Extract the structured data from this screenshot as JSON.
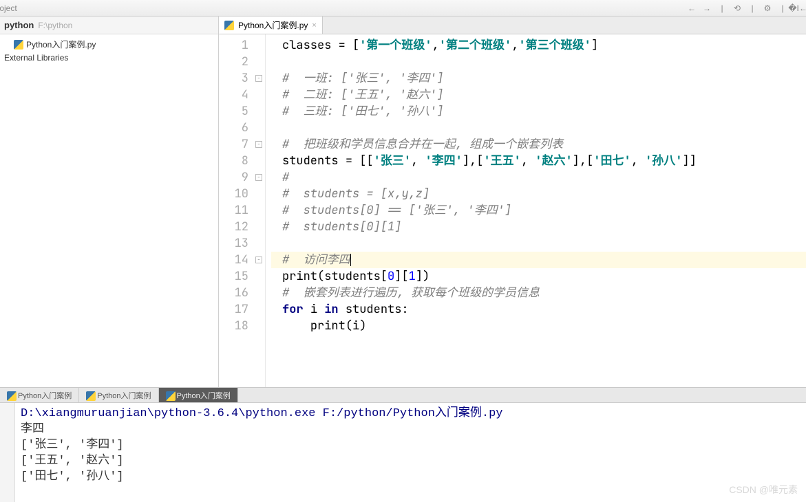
{
  "toolbar": {
    "icons": [
      "oject",
      "back",
      "forward",
      "sync",
      "gear",
      "collapse"
    ]
  },
  "project": {
    "name": "python",
    "path": "F:\\python",
    "file": "Python入门案例.py",
    "external_libs": "External Libraries"
  },
  "editor_tab": {
    "label": "Python入门案例.py"
  },
  "code": {
    "lines": [
      {
        "n": 1,
        "tokens": [
          {
            "t": "id",
            "v": "classes "
          },
          {
            "t": "op",
            "v": "= ["
          },
          {
            "t": "str",
            "v": "'第一个班级'"
          },
          {
            "t": "op",
            "v": ","
          },
          {
            "t": "str",
            "v": "'第二个班级'"
          },
          {
            "t": "op",
            "v": ","
          },
          {
            "t": "str",
            "v": "'第三个班级'"
          },
          {
            "t": "op",
            "v": "]"
          }
        ]
      },
      {
        "n": 2,
        "tokens": []
      },
      {
        "n": 3,
        "fold": true,
        "tokens": [
          {
            "t": "com",
            "v": "#  一班: ['张三', '李四']"
          }
        ]
      },
      {
        "n": 4,
        "tokens": [
          {
            "t": "com",
            "v": "#  二班: ['王五', '赵六']"
          }
        ]
      },
      {
        "n": 5,
        "tokens": [
          {
            "t": "com",
            "v": "#  三班: ['田七', '孙八']"
          }
        ]
      },
      {
        "n": 6,
        "tokens": []
      },
      {
        "n": 7,
        "fold": true,
        "tokens": [
          {
            "t": "com",
            "v": "#  把班级和学员信息合并在一起, 组成一个嵌套列表"
          }
        ]
      },
      {
        "n": 8,
        "tokens": [
          {
            "t": "id",
            "v": "students "
          },
          {
            "t": "op",
            "v": "= [["
          },
          {
            "t": "str",
            "v": "'张三'"
          },
          {
            "t": "op",
            "v": ", "
          },
          {
            "t": "str",
            "v": "'李四'"
          },
          {
            "t": "op",
            "v": "],["
          },
          {
            "t": "str",
            "v": "'王五'"
          },
          {
            "t": "op",
            "v": ", "
          },
          {
            "t": "str",
            "v": "'赵六'"
          },
          {
            "t": "op",
            "v": "],["
          },
          {
            "t": "str",
            "v": "'田七'"
          },
          {
            "t": "op",
            "v": ", "
          },
          {
            "t": "str",
            "v": "'孙八'"
          },
          {
            "t": "op",
            "v": "]]"
          }
        ]
      },
      {
        "n": 9,
        "fold": true,
        "tokens": [
          {
            "t": "com",
            "v": "#"
          }
        ]
      },
      {
        "n": 10,
        "tokens": [
          {
            "t": "com",
            "v": "#  students = [x,y,z]"
          }
        ]
      },
      {
        "n": 11,
        "tokens": [
          {
            "t": "com",
            "v": "#  students[0] == ['张三', '李四']"
          }
        ]
      },
      {
        "n": 12,
        "tokens": [
          {
            "t": "com",
            "v": "#  students[0][1]"
          }
        ]
      },
      {
        "n": 13,
        "tokens": []
      },
      {
        "n": 14,
        "fold": true,
        "hl": true,
        "tokens": [
          {
            "t": "com",
            "v": "#  访问李四"
          },
          {
            "t": "caret",
            "v": ""
          }
        ]
      },
      {
        "n": 15,
        "tokens": [
          {
            "t": "fn",
            "v": "print"
          },
          {
            "t": "op",
            "v": "(students["
          },
          {
            "t": "num",
            "v": "0"
          },
          {
            "t": "op",
            "v": "]["
          },
          {
            "t": "num",
            "v": "1"
          },
          {
            "t": "op",
            "v": "])"
          }
        ]
      },
      {
        "n": 16,
        "tokens": [
          {
            "t": "com",
            "v": "#  嵌套列表进行遍历, 获取每个班级的学员信息"
          }
        ]
      },
      {
        "n": 17,
        "tokens": [
          {
            "t": "kw",
            "v": "for "
          },
          {
            "t": "id",
            "v": "i "
          },
          {
            "t": "kw",
            "v": "in "
          },
          {
            "t": "id",
            "v": "students:"
          }
        ]
      },
      {
        "n": 18,
        "indent": 1,
        "tokens": [
          {
            "t": "fn",
            "v": "print"
          },
          {
            "t": "op",
            "v": "(i)"
          }
        ]
      }
    ]
  },
  "run_tabs": [
    {
      "label": "Python入门案例",
      "active": false
    },
    {
      "label": "Python入门案例",
      "active": false
    },
    {
      "label": "Python入门案例",
      "active": true
    }
  ],
  "console": {
    "cmd_prefix": "D:\\xiangmuruanjian\\python-3.6.4\\python.exe ",
    "cmd_path": "F:/python/Python入门案例.py",
    "output": [
      "李四",
      "['张三', '李四']",
      "['王五', '赵六']",
      "['田七', '孙八']"
    ]
  },
  "watermark": "CSDN @唯元素"
}
